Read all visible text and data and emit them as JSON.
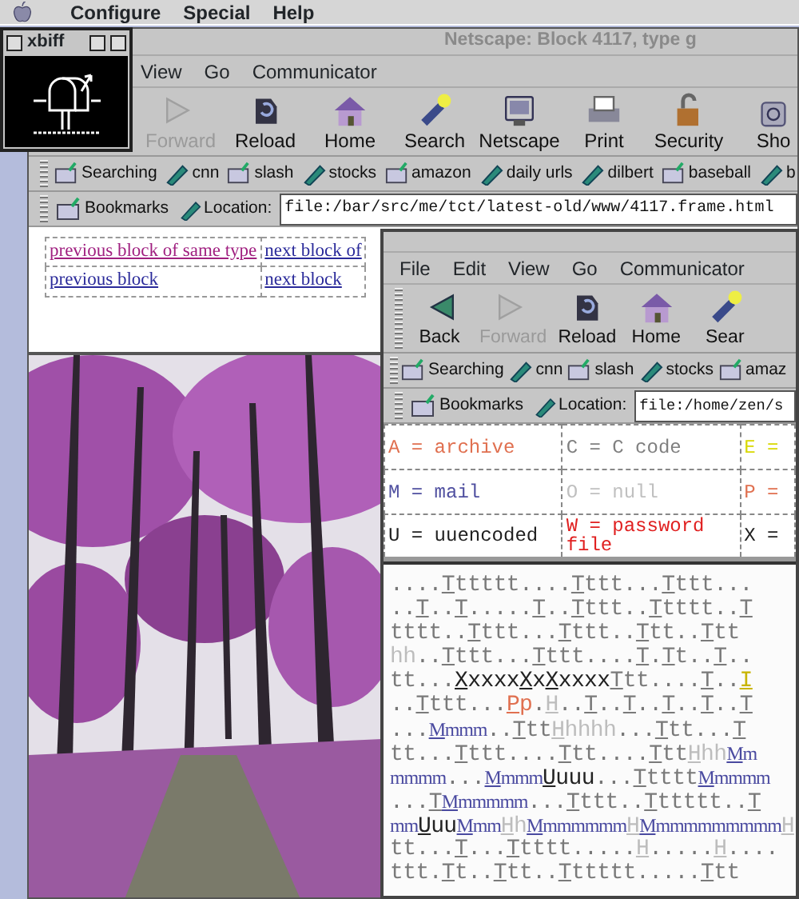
{
  "menu_bar": {
    "items": [
      "Configure",
      "Special",
      "Help"
    ]
  },
  "xbiff": {
    "title": "xbiff"
  },
  "windows": [
    {
      "title": "Netscape: Block 4117, type g",
      "menus": [
        "View",
        "Go",
        "Communicator"
      ],
      "toolbar": [
        {
          "label": "Forward",
          "kind": "forward",
          "disabled": true
        },
        {
          "label": "Reload",
          "kind": "reload",
          "disabled": false
        },
        {
          "label": "Home",
          "kind": "home",
          "disabled": false
        },
        {
          "label": "Search",
          "kind": "search",
          "disabled": false
        },
        {
          "label": "Netscape",
          "kind": "portal",
          "disabled": false
        },
        {
          "label": "Print",
          "kind": "print",
          "disabled": false
        },
        {
          "label": "Security",
          "kind": "security",
          "disabled": false
        },
        {
          "label": "Sho",
          "kind": "shop",
          "disabled": false
        }
      ],
      "personal_toolbar": [
        {
          "label": "Searching",
          "kind": "folder"
        },
        {
          "label": "cnn",
          "kind": "bookmark"
        },
        {
          "label": "slash",
          "kind": "folder"
        },
        {
          "label": "stocks",
          "kind": "bookmark"
        },
        {
          "label": "amazon",
          "kind": "folder"
        },
        {
          "label": "daily urls",
          "kind": "bookmark"
        },
        {
          "label": "dilbert",
          "kind": "bookmark"
        },
        {
          "label": "baseball",
          "kind": "folder"
        },
        {
          "label": "b",
          "kind": "bookmark"
        }
      ],
      "location": {
        "bookmarks": "Bookmarks",
        "label": "Location:",
        "value": "file:/bar/src/me/tct/latest-old/www/4117.frame.html"
      },
      "nav_links": [
        [
          {
            "text": "previous block of same type",
            "visited": true
          },
          {
            "text": "next block of",
            "visited": false
          }
        ],
        [
          {
            "text": "previous block",
            "visited": false
          },
          {
            "text": "next block",
            "visited": false
          }
        ]
      ]
    },
    {
      "menus": [
        "File",
        "Edit",
        "View",
        "Go",
        "Communicator"
      ],
      "toolbar": [
        {
          "label": "Back",
          "kind": "back",
          "disabled": false
        },
        {
          "label": "Forward",
          "kind": "forward",
          "disabled": true
        },
        {
          "label": "Reload",
          "kind": "reload",
          "disabled": false
        },
        {
          "label": "Home",
          "kind": "home",
          "disabled": false
        },
        {
          "label": "Sear",
          "kind": "search",
          "disabled": false
        }
      ],
      "personal_toolbar": [
        {
          "label": "Searching",
          "kind": "folder"
        },
        {
          "label": "cnn",
          "kind": "bookmark"
        },
        {
          "label": "slash",
          "kind": "folder"
        },
        {
          "label": "stocks",
          "kind": "bookmark"
        },
        {
          "label": "amaz",
          "kind": "folder"
        }
      ],
      "location": {
        "bookmarks": "Bookmarks",
        "label": "Location:",
        "value": "file:/home/zen/s"
      },
      "legend": [
        [
          {
            "text": "A = archive",
            "color": "#e07050"
          },
          {
            "text": "C = C code",
            "color": "#808080"
          },
          {
            "text": "E =",
            "color": "#d8d800"
          }
        ],
        [
          {
            "text": "M = mail",
            "color": "#5050a0"
          },
          {
            "text": "O = null",
            "color": "#c0c0c0"
          },
          {
            "text": "P =",
            "color": "#e07050"
          }
        ],
        [
          {
            "text": "U = uuencoded",
            "color": "#202020"
          },
          {
            "text": "W = password file",
            "color": "#e02020"
          },
          {
            "text": "X =",
            "color": "#202020"
          }
        ]
      ],
      "file_map": [
        [
          {
            "text": "....",
            "kind": "dot"
          },
          {
            "text": "Tttttt",
            "kind": "t"
          },
          {
            "text": "....",
            "kind": "dot"
          },
          {
            "text": "Tttt",
            "kind": "t"
          },
          {
            "text": "...",
            "kind": "dot"
          },
          {
            "text": "Tttt",
            "kind": "t"
          },
          {
            "text": "...",
            "kind": "dot"
          }
        ],
        [
          {
            "text": "..",
            "kind": "dot"
          },
          {
            "text": "T",
            "kind": "t"
          },
          {
            "text": "..",
            "kind": "dot"
          },
          {
            "text": "T",
            "kind": "t"
          },
          {
            "text": ".....",
            "kind": "dot"
          },
          {
            "text": "T",
            "kind": "t"
          },
          {
            "text": "..",
            "kind": "dot"
          },
          {
            "text": "Tttt",
            "kind": "t"
          },
          {
            "text": "..",
            "kind": "dot"
          },
          {
            "text": "Ttttt",
            "kind": "t"
          },
          {
            "text": "..",
            "kind": "dot"
          },
          {
            "text": "T",
            "kind": "t"
          }
        ],
        [
          {
            "text": "tttt",
            "kind": "t",
            "continued": true
          },
          {
            "text": "..",
            "kind": "dot"
          },
          {
            "text": "Tttt",
            "kind": "t"
          },
          {
            "text": "...",
            "kind": "dot"
          },
          {
            "text": "Tttt",
            "kind": "t"
          },
          {
            "text": "..",
            "kind": "dot"
          },
          {
            "text": "Ttt",
            "kind": "t"
          },
          {
            "text": "..",
            "kind": "dot"
          },
          {
            "text": "Ttt",
            "kind": "t"
          }
        ],
        [
          {
            "text": "hh",
            "kind": "h",
            "continued": true
          },
          {
            "text": "..",
            "kind": "dot"
          },
          {
            "text": "Tttt",
            "kind": "t"
          },
          {
            "text": "...",
            "kind": "dot"
          },
          {
            "text": "Tttt",
            "kind": "t"
          },
          {
            "text": "....",
            "kind": "dot"
          },
          {
            "text": "T",
            "kind": "t"
          },
          {
            "text": ".",
            "kind": "dot"
          },
          {
            "text": "Tt",
            "kind": "t"
          },
          {
            "text": "..",
            "kind": "dot"
          },
          {
            "text": "T",
            "kind": "t"
          },
          {
            "text": "..",
            "kind": "dot"
          }
        ],
        [
          {
            "text": "tt",
            "kind": "t",
            "continued": true
          },
          {
            "text": "...",
            "kind": "dot"
          },
          {
            "text": "Xxxxx",
            "kind": "x"
          },
          {
            "text": "Xx",
            "kind": "x"
          },
          {
            "text": "Xxxxx",
            "kind": "x"
          },
          {
            "text": "Ttt",
            "kind": "t"
          },
          {
            "text": "....",
            "kind": "dot"
          },
          {
            "text": "T",
            "kind": "t"
          },
          {
            "text": "..",
            "kind": "dot"
          },
          {
            "text": "I",
            "kind": "i"
          }
        ],
        [
          {
            "text": "..",
            "kind": "dot"
          },
          {
            "text": "Tttt",
            "kind": "t"
          },
          {
            "text": "...",
            "kind": "dot"
          },
          {
            "text": "Pp",
            "kind": "p"
          },
          {
            "text": ".",
            "kind": "dot"
          },
          {
            "text": "H",
            "kind": "h"
          },
          {
            "text": "..",
            "kind": "dot"
          },
          {
            "text": "T",
            "kind": "t"
          },
          {
            "text": "..",
            "kind": "dot"
          },
          {
            "text": "T",
            "kind": "t"
          },
          {
            "text": "..",
            "kind": "dot"
          },
          {
            "text": "T",
            "kind": "t"
          },
          {
            "text": "..",
            "kind": "dot"
          },
          {
            "text": "T",
            "kind": "t"
          },
          {
            "text": "..",
            "kind": "dot"
          },
          {
            "text": "T",
            "kind": "t"
          }
        ],
        [
          {
            "text": "...",
            "kind": "dot"
          },
          {
            "text": "Mmmm",
            "kind": "m"
          },
          {
            "text": "..",
            "kind": "dot"
          },
          {
            "text": "Ttt",
            "kind": "t"
          },
          {
            "text": "Hhhhh",
            "kind": "h"
          },
          {
            "text": "...",
            "kind": "dot"
          },
          {
            "text": "Ttt",
            "kind": "t"
          },
          {
            "text": "...",
            "kind": "dot"
          },
          {
            "text": "T",
            "kind": "t"
          }
        ],
        [
          {
            "text": "tt",
            "kind": "t",
            "continued": true
          },
          {
            "text": "...",
            "kind": "dot"
          },
          {
            "text": "Tttt",
            "kind": "t"
          },
          {
            "text": "....",
            "kind": "dot"
          },
          {
            "text": "Ttt",
            "kind": "t"
          },
          {
            "text": "....",
            "kind": "dot"
          },
          {
            "text": "Ttt",
            "kind": "t"
          },
          {
            "text": "Hhh",
            "kind": "h"
          },
          {
            "text": "Mm",
            "kind": "m"
          }
        ],
        [
          {
            "text": "mmmm",
            "kind": "m",
            "continued": true
          },
          {
            "text": "...",
            "kind": "dot"
          },
          {
            "text": "Mmmm",
            "kind": "m"
          },
          {
            "text": "Uuuu",
            "kind": "u"
          },
          {
            "text": "...",
            "kind": "dot"
          },
          {
            "text": "Ttttt",
            "kind": "t"
          },
          {
            "text": "Mmmmm",
            "kind": "m"
          }
        ],
        [
          {
            "text": "...",
            "kind": "dot"
          },
          {
            "text": "T",
            "kind": "t"
          },
          {
            "text": "Mmmmmm",
            "kind": "m"
          },
          {
            "text": "...",
            "kind": "dot"
          },
          {
            "text": "Tttt",
            "kind": "t"
          },
          {
            "text": "..",
            "kind": "dot"
          },
          {
            "text": "Tttttt",
            "kind": "t"
          },
          {
            "text": "..",
            "kind": "dot"
          },
          {
            "text": "T",
            "kind": "t"
          }
        ],
        [
          {
            "text": "mm",
            "kind": "m",
            "continued": true
          },
          {
            "text": "Uuu",
            "kind": "u"
          },
          {
            "text": "Mmm",
            "kind": "m"
          },
          {
            "text": "Hh",
            "kind": "h"
          },
          {
            "text": "Mmmmmmm",
            "kind": "m"
          },
          {
            "text": "H",
            "kind": "h"
          },
          {
            "text": "Mmmmmmmmmm",
            "kind": "m"
          },
          {
            "text": "H",
            "kind": "h"
          }
        ],
        [
          {
            "text": "tt",
            "kind": "t",
            "continued": true
          },
          {
            "text": "...",
            "kind": "dot"
          },
          {
            "text": "T",
            "kind": "t"
          },
          {
            "text": "...",
            "kind": "dot"
          },
          {
            "text": "Ttttt",
            "kind": "t"
          },
          {
            "text": ".....",
            "kind": "dot"
          },
          {
            "text": "H",
            "kind": "h"
          },
          {
            "text": ".....",
            "kind": "dot"
          },
          {
            "text": "H",
            "kind": "h"
          },
          {
            "text": "....",
            "kind": "dot"
          }
        ],
        [
          {
            "text": "ttt",
            "kind": "t",
            "continued": true
          },
          {
            "text": ".",
            "kind": "dot"
          },
          {
            "text": "Tt",
            "kind": "t"
          },
          {
            "text": "..",
            "kind": "dot"
          },
          {
            "text": "Ttt",
            "kind": "t"
          },
          {
            "text": "..",
            "kind": "dot"
          },
          {
            "text": "Tttttt",
            "kind": "t"
          },
          {
            "text": ".....",
            "kind": "dot"
          },
          {
            "text": "Ttt",
            "kind": "t"
          }
        ]
      ]
    }
  ]
}
